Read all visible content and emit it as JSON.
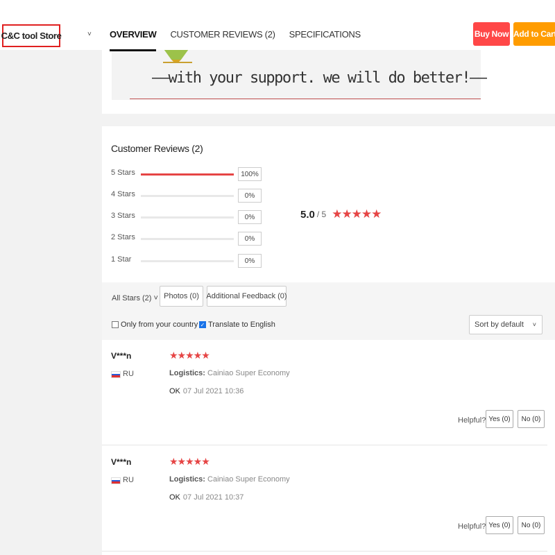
{
  "header": {
    "store_name": "C&C tool Store",
    "store_chevron": "˅",
    "tabs": [
      {
        "label": "OVERVIEW",
        "active": true
      },
      {
        "label": "CUSTOMER REVIEWS (2)",
        "active": false
      },
      {
        "label": "SPECIFICATIONS",
        "active": false
      }
    ],
    "buy_now": "Buy Now",
    "add_to_cart": "Add to Cart"
  },
  "banner": {
    "text": "——with your support. we will do better!——"
  },
  "reviews": {
    "title": "Customer Reviews (2)",
    "breakdown": [
      {
        "label": "5 Stars",
        "percent_text": "100%",
        "percent": 100
      },
      {
        "label": "4 Stars",
        "percent_text": "0%",
        "percent": 0
      },
      {
        "label": "3 Stars",
        "percent_text": "0%",
        "percent": 0
      },
      {
        "label": "2 Stars",
        "percent_text": "0%",
        "percent": 0
      },
      {
        "label": "1 Star",
        "percent_text": "0%",
        "percent": 0
      }
    ],
    "average": "5.0",
    "out_of": "/ 5",
    "average_stars": "★★★★★",
    "filters": {
      "all_stars": "All Stars (2) ˅",
      "photos": "Photos (0)",
      "additional_feedback": "Additional Feedback (0)",
      "only_country": "Only from your country",
      "translate": "Translate to English",
      "sort": "Sort by default",
      "sort_chevron": "˅"
    },
    "items": [
      {
        "user": "V***n",
        "country": "RU",
        "stars": "★★★★★",
        "logistics_label": "Logistics:",
        "logistics_value": "Cainiao Super Economy",
        "text": "OK",
        "date": "07 Jul 2021 10:36",
        "helpful": "Helpful?",
        "yes": "Yes (0)",
        "no": "No (0)"
      },
      {
        "user": "V***n",
        "country": "RU",
        "stars": "★★★★★",
        "logistics_label": "Logistics:",
        "logistics_value": "Cainiao Super Economy",
        "text": "OK",
        "date": "07 Jul 2021 10:37",
        "helpful": "Helpful?",
        "yes": "Yes (0)",
        "no": "No (0)"
      }
    ]
  },
  "colors": {
    "accent_red": "#ff4747",
    "accent_orange": "#ff9c00",
    "star_red": "#e64545",
    "checkbox_blue": "#1a73e8"
  }
}
